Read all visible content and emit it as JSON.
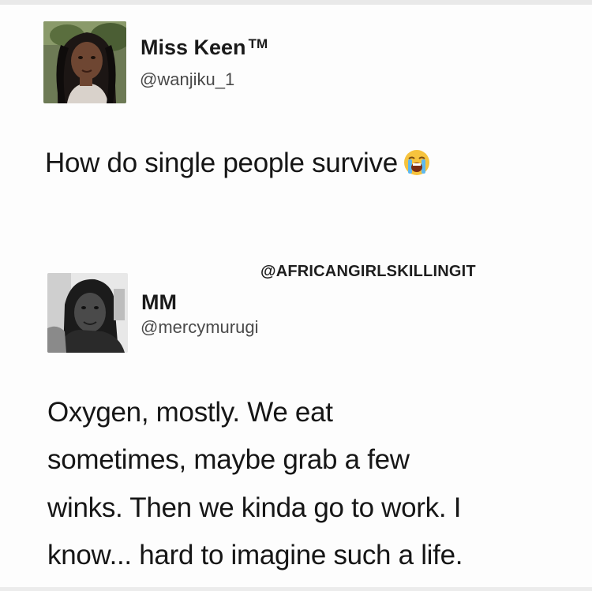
{
  "tweet": {
    "author_name": "Miss Keen",
    "author_badge": "TM",
    "author_handle": "@wanjiku_1",
    "text": "How do single people survive",
    "emoji": "loudly-crying-face-emoji"
  },
  "watermark": "@AFRICANGIRLSKILLINGIT",
  "reply": {
    "author_name": "MM",
    "author_handle": "@mercymurugi",
    "lines": [
      "Oxygen, mostly. We eat",
      "sometimes, maybe grab a few",
      "winks. Then we kinda go to work. I",
      "know... hard to imagine such a life."
    ]
  },
  "colors": {
    "background": "#fdfdfd",
    "text": "#161616",
    "handle": "#4a4a4a",
    "emoji_face": "#f6c33e"
  }
}
